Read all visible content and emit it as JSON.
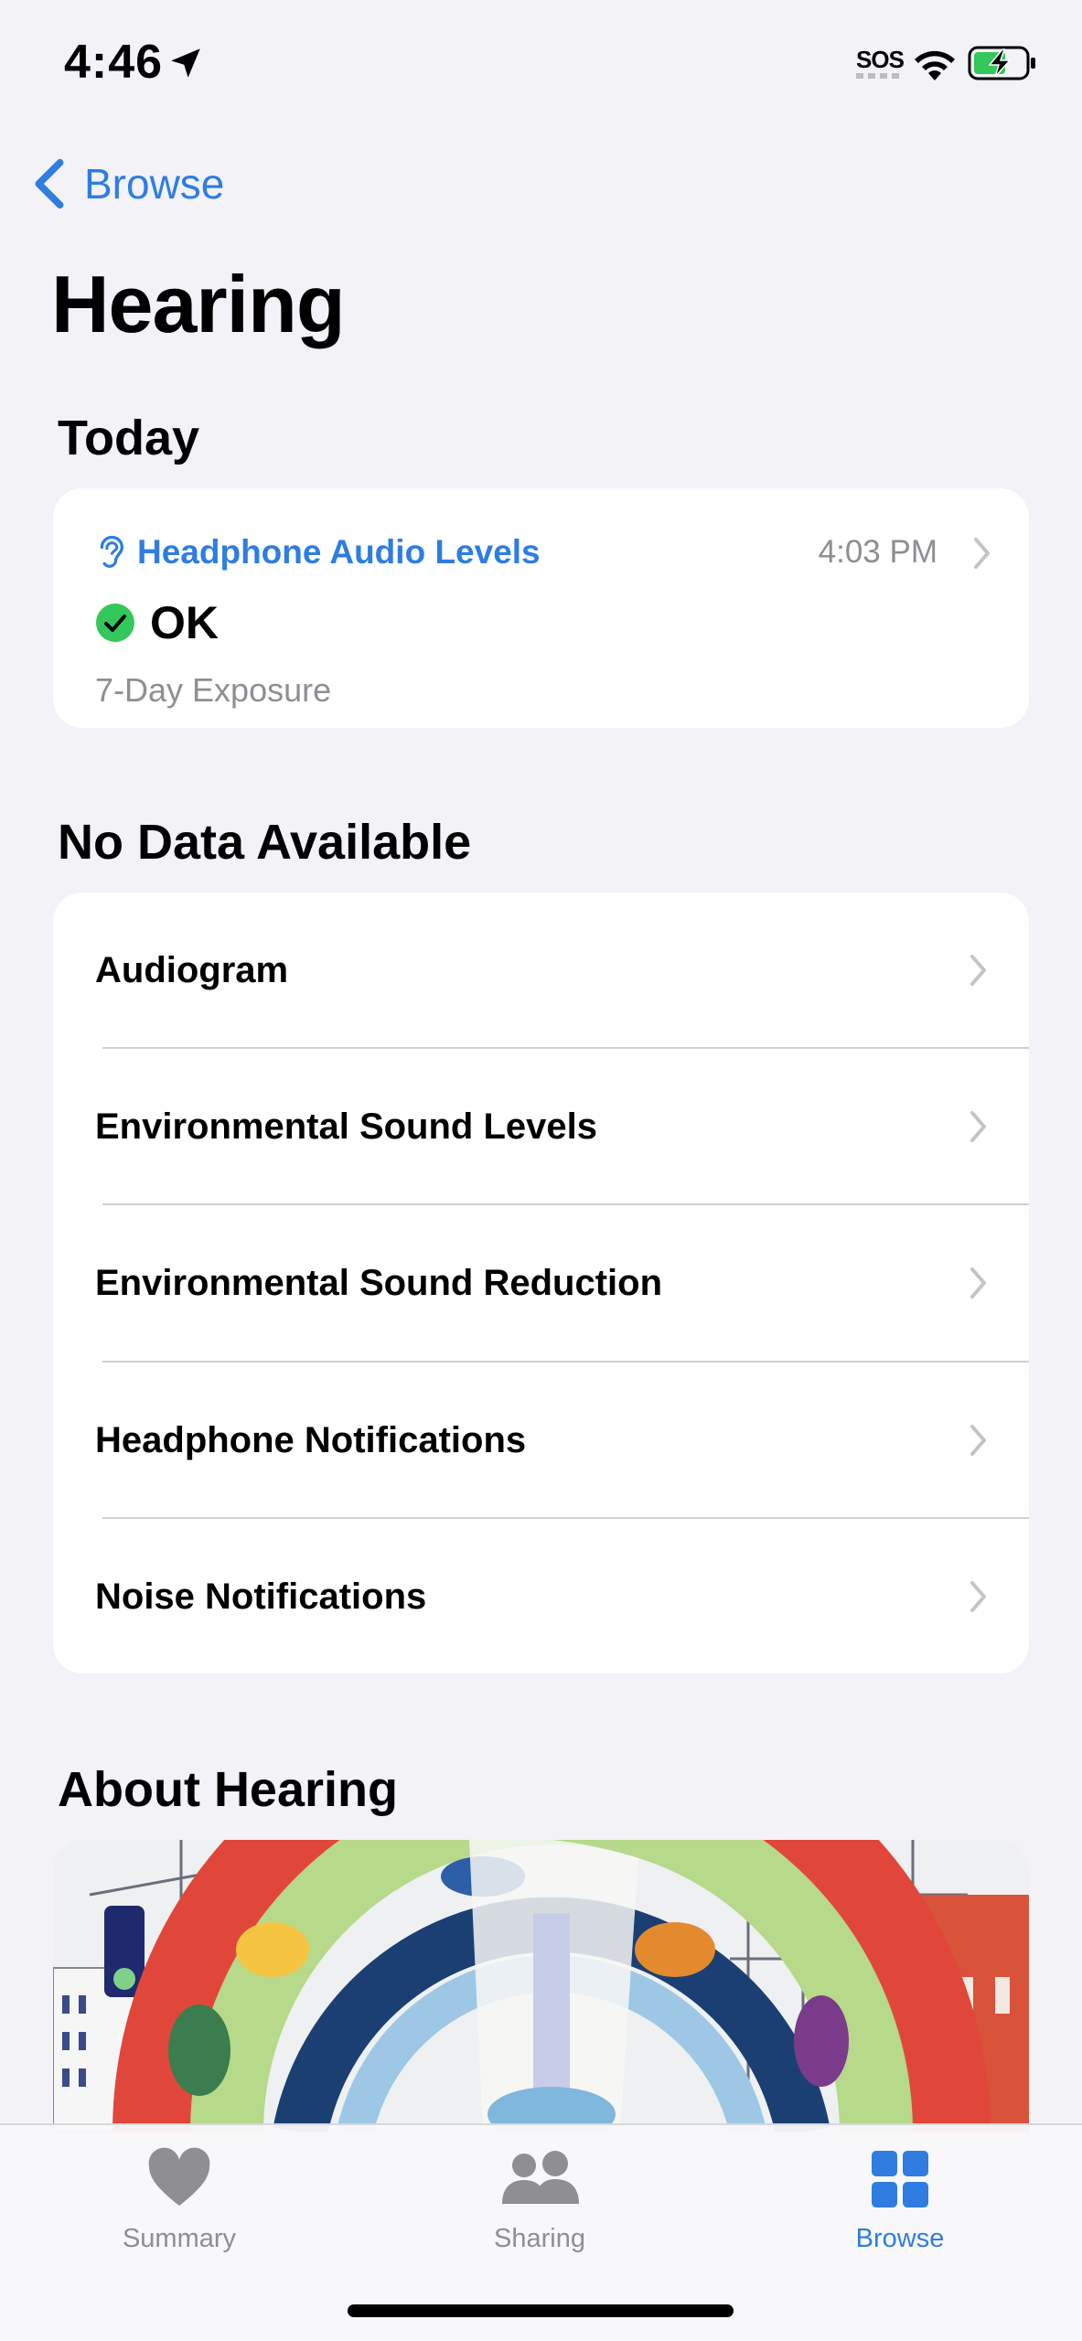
{
  "status_bar": {
    "time": "4:46",
    "carrier": "SOS"
  },
  "nav": {
    "back_label": "Browse"
  },
  "page": {
    "title": "Hearing"
  },
  "today": {
    "header": "Today",
    "card": {
      "title": "Headphone Audio Levels",
      "time": "4:03 PM",
      "status": "OK",
      "subtitle": "7-Day Exposure",
      "status_color": "#34c759"
    }
  },
  "no_data": {
    "header": "No Data Available",
    "items": [
      {
        "label": "Audiogram"
      },
      {
        "label": "Environmental Sound Levels"
      },
      {
        "label": "Environmental Sound Reduction"
      },
      {
        "label": "Headphone Notifications"
      },
      {
        "label": "Noise Notifications"
      }
    ]
  },
  "about": {
    "header": "About Hearing",
    "image": "colorful-illustration-headphones-city"
  },
  "tab_bar": {
    "items": [
      {
        "label": "Summary",
        "icon": "heart-icon",
        "active": false
      },
      {
        "label": "Sharing",
        "icon": "people-icon",
        "active": false
      },
      {
        "label": "Browse",
        "icon": "grid-icon",
        "active": true
      }
    ]
  },
  "colors": {
    "accent": "#2f7de1",
    "background": "#f2f2f7",
    "secondary_text": "#8e8e93"
  }
}
